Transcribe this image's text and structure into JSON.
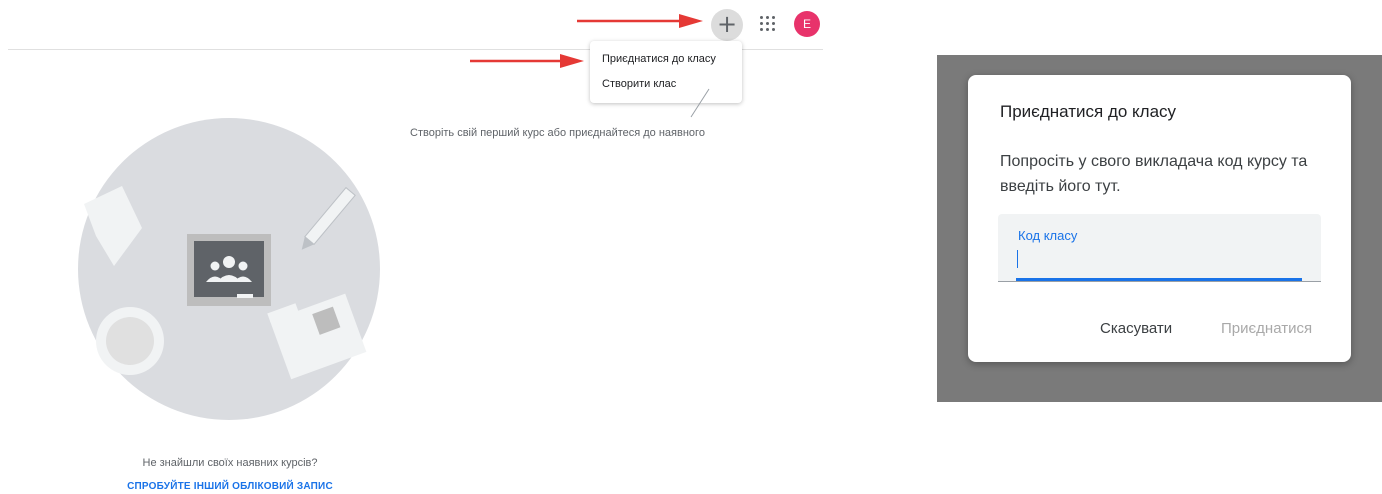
{
  "header": {
    "add_icon": "plus-icon",
    "apps_icon": "apps-grid-icon",
    "avatar_letter": "E"
  },
  "menu": {
    "items": [
      {
        "label": "Приєднатися до класу"
      },
      {
        "label": "Створити клас"
      }
    ]
  },
  "hint": {
    "text": "Створіть свій перший курс або приєднайтеся до наявного"
  },
  "empty_state": {
    "not_found": "Не знайшли своїх наявних курсів?",
    "try_other": "СПРОБУЙТЕ ІНШИЙ ОБЛІКОВИЙ ЗАПИС"
  },
  "dialog": {
    "title": "Приєднатися до класу",
    "description": "Попросіть у свого викладача код курсу та введіть його тут.",
    "field_label": "Код класу",
    "field_value": "",
    "cancel_label": "Скасувати",
    "join_label": "Приєднатися"
  },
  "colors": {
    "accent": "#1a73e8",
    "avatar": "#e8336b",
    "arrow": "#e53935",
    "overlay": "#7a7a7a"
  }
}
